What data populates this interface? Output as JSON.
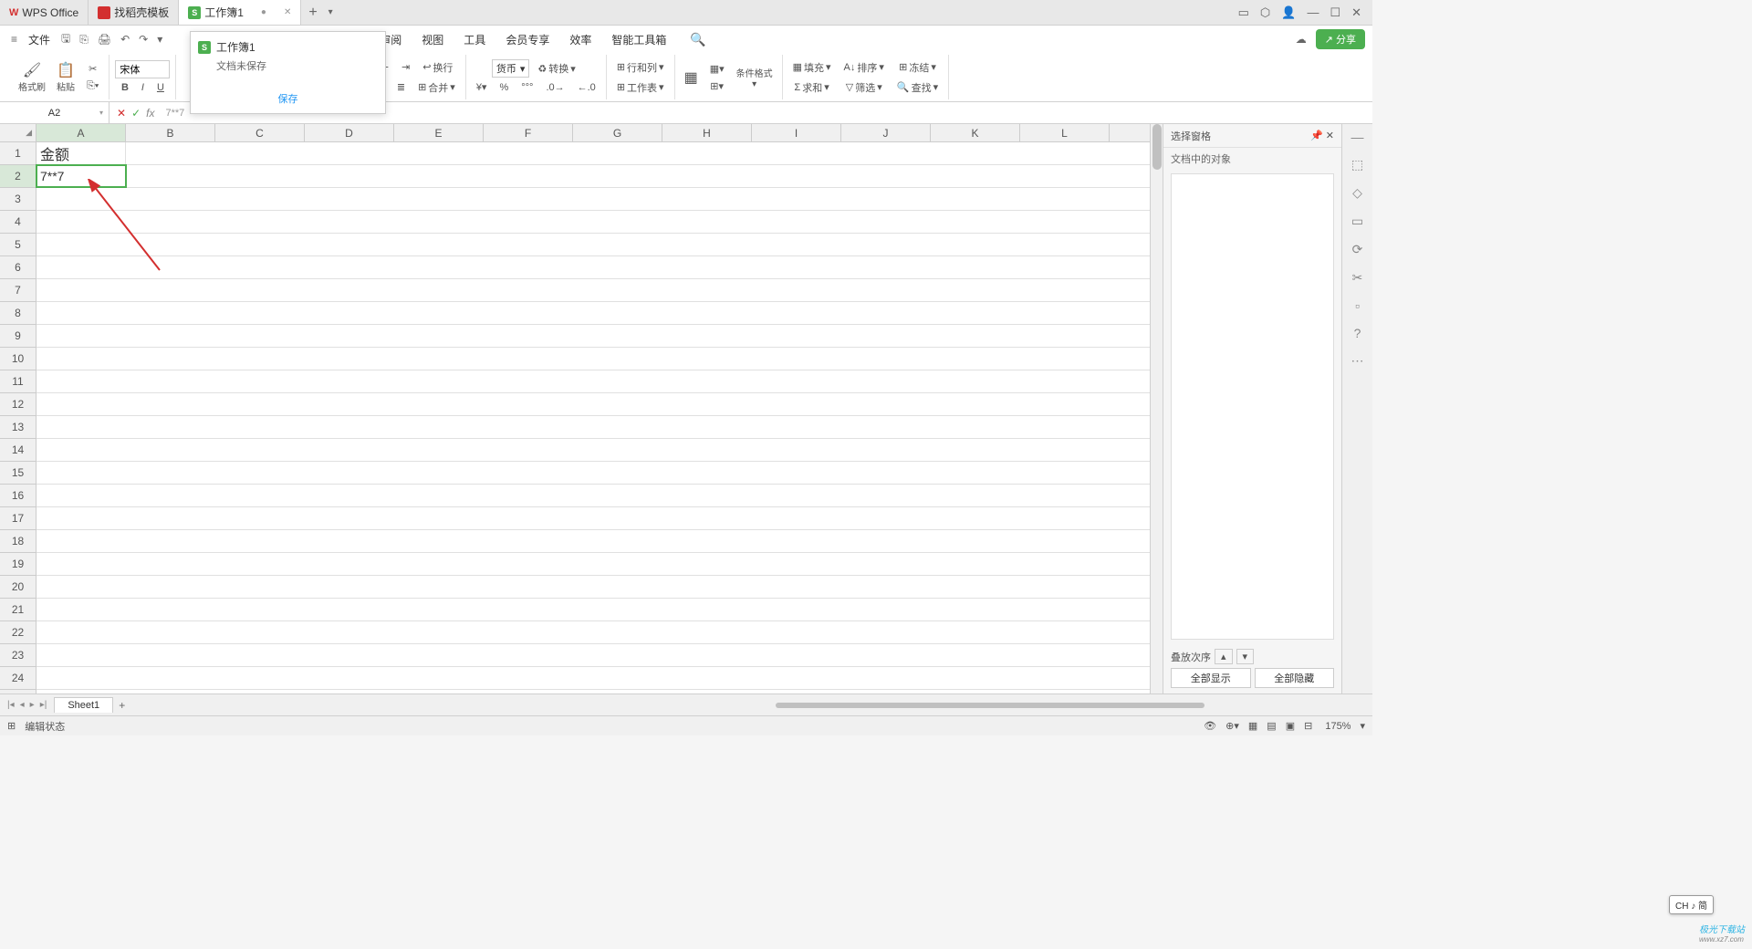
{
  "titlebar": {
    "app": "WPS Office",
    "tab_templates": "找稻壳模板",
    "tab_workbook": "工作簿1",
    "add": "+",
    "menu": "▾"
  },
  "tooltip": {
    "title": "工作簿1",
    "sub": "文档未保存",
    "action": "保存"
  },
  "menubar": {
    "file": "文件",
    "items": [
      "审阅",
      "视图",
      "工具",
      "会员专享",
      "效率",
      "智能工具箱"
    ]
  },
  "share": "分享",
  "ribbon": {
    "format_painter": "格式刷",
    "paste": "粘贴",
    "font": "宋体",
    "currency": "货币",
    "convert": "转换",
    "wrap": "换行",
    "merge": "合并",
    "rowcol": "行和列",
    "worksheet": "工作表",
    "cond_format": "条件格式",
    "fill": "填充",
    "sort": "排序",
    "sum": "求和",
    "filter": "筛选",
    "freeze": "冻结",
    "find": "查找"
  },
  "formula_bar": {
    "cell_ref": "A2",
    "formula": "7**7"
  },
  "columns": [
    "A",
    "B",
    "C",
    "D",
    "E",
    "F",
    "G",
    "H",
    "I",
    "J",
    "K",
    "L"
  ],
  "rows": [
    "1",
    "2",
    "3",
    "4",
    "5",
    "6",
    "7",
    "8",
    "9",
    "10",
    "11",
    "12",
    "13",
    "14",
    "15",
    "16",
    "17",
    "18",
    "19",
    "20",
    "21",
    "22",
    "23",
    "24"
  ],
  "cells": {
    "A1": "金额",
    "A2": "7**7"
  },
  "right_panel": {
    "title": "选择窗格",
    "sub": "文档中的对象",
    "stack": "叠放次序",
    "show_all": "全部显示",
    "hide_all": "全部隐藏"
  },
  "sheet_tabs": {
    "sheet1": "Sheet1"
  },
  "statusbar": {
    "status": "编辑状态",
    "zoom": "175%"
  },
  "ime": "CH ♪ 简",
  "watermark": {
    "main": "极光下载站",
    "sub": "www.xz7.com"
  }
}
